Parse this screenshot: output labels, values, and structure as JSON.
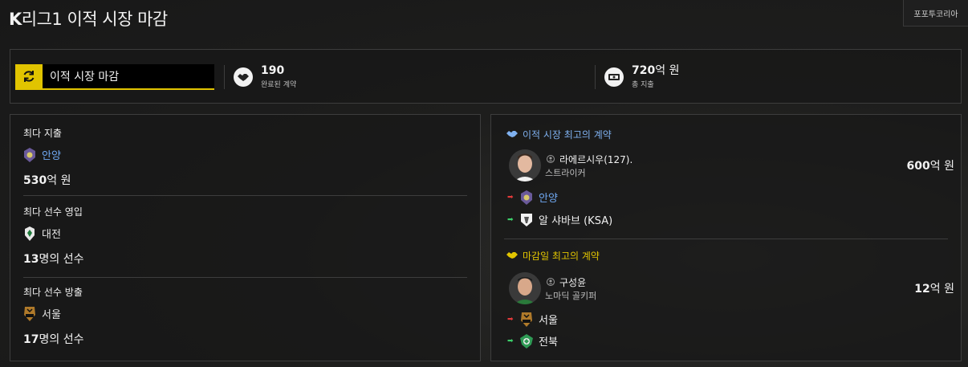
{
  "page": {
    "title_bold": "K",
    "title_rest": "리그1 이적 시장 마감",
    "corner_button": "포포투코리아"
  },
  "summary": {
    "status_label": "이적 시장 마감",
    "deals_value": "190",
    "deals_label": "완료된 계약",
    "spend_value": "720",
    "spend_unit": "억 원",
    "spend_label": "총 지출"
  },
  "left": {
    "most_spent": {
      "heading": "최다 지출",
      "team": "안양",
      "amount": "530",
      "amount_unit": "억 원"
    },
    "most_signed": {
      "heading": "최다 선수 영입",
      "team": "대전",
      "count": "13",
      "count_unit": "명의 선수"
    },
    "most_released": {
      "heading": "최다 선수 방출",
      "team": "서울",
      "count": "17",
      "count_unit": "명의 선수"
    }
  },
  "right": {
    "best_window_deal": {
      "heading": "이적 시장 최고의 계약",
      "player_name": "라에르시우(127).",
      "position": "스트라이커",
      "fee": "600",
      "fee_unit": "억 원",
      "from_team": "안양",
      "to_team": "알 샤바브 (KSA)"
    },
    "best_deadline_deal": {
      "heading": "마감일 최고의 계약",
      "player_name": "구성윤",
      "position": "노마딕 골키퍼",
      "fee": "12",
      "fee_unit": "억 원",
      "from_team": "서울",
      "to_team": "전북"
    }
  },
  "colors": {
    "accent_yellow": "#e1c400",
    "link_blue": "#6fa8f2",
    "arrow_out": "#e23a3a",
    "arrow_in": "#3ccf6a"
  }
}
